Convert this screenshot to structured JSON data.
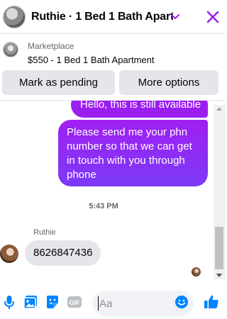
{
  "header": {
    "title": "Ruthie · 1 Bed 1 Bath Apart...",
    "accent": "#9b1df0"
  },
  "listing": {
    "label": "Marketplace",
    "item": "$550 - 1 Bed 1 Bath Apartment"
  },
  "actions": {
    "pending_label": "Mark as pending",
    "more_label": "More options"
  },
  "messages": {
    "outgoing_partial": "Hello, this is still available",
    "outgoing": "Please send me your phn number so that we can get in touch with you through phone",
    "timestamp": "5:43 PM",
    "sender_name": "Ruthie",
    "incoming": "8626847436"
  },
  "composer": {
    "placeholder": "Aa",
    "icons": [
      "microphone-icon",
      "photo-icon",
      "sticker-icon",
      "gif-icon",
      "emoji-icon",
      "like-icon"
    ]
  },
  "colors": {
    "bubble_out": "#9b1df0",
    "bubble_in": "#e4e6eb",
    "icon_blue": "#0084ff"
  }
}
